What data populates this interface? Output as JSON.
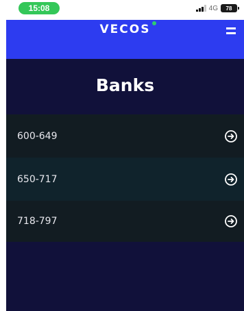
{
  "status_bar": {
    "time": "15:08",
    "network": "4G",
    "battery": "78"
  },
  "header": {
    "logo": "VECOS",
    "menu_icon": "hamburger-menu-icon"
  },
  "page": {
    "title": "Banks"
  },
  "banks": [
    {
      "label": "600-649",
      "icon": "arrow-right-circle-icon"
    },
    {
      "label": "650-717",
      "icon": "arrow-right-circle-icon"
    },
    {
      "label": "718-797",
      "icon": "arrow-right-circle-icon"
    }
  ],
  "colors": {
    "header_bg": "#2d3cf0",
    "page_bg": "#11113a",
    "row_dark": "#121c22",
    "row_alt": "#10232c",
    "time_pill": "#34c759",
    "logo_dot": "#2ecc71"
  }
}
